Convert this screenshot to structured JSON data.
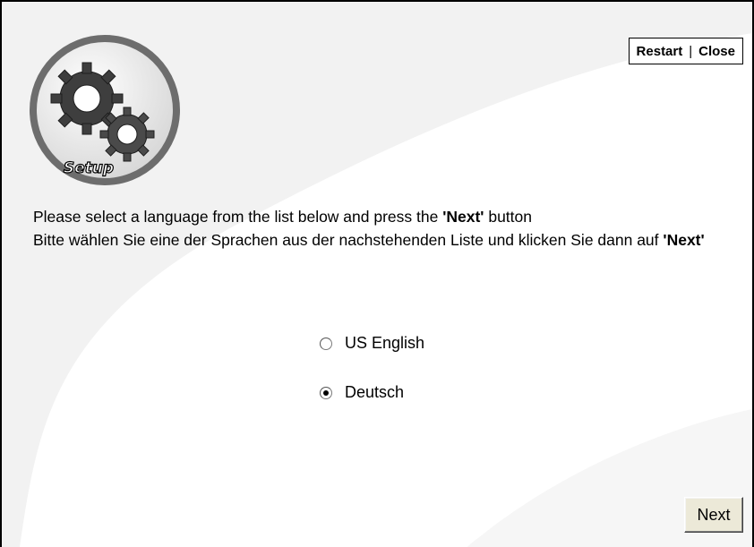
{
  "header": {
    "logo_label": "Setup",
    "restart_label": "Restart",
    "separator": "|",
    "close_label": "Close"
  },
  "instructions": {
    "en_prefix": "Please select a language from the list below and press the ",
    "en_bold": "'Next'",
    "en_suffix": " button",
    "de_prefix": "Bitte wählen Sie eine der Sprachen aus der nachstehenden Liste und klicken Sie dann auf ",
    "de_bold": "'Next'"
  },
  "languages": [
    {
      "label": "US English",
      "selected": false
    },
    {
      "label": "Deutsch",
      "selected": true
    }
  ],
  "footer": {
    "next_label": "Next"
  },
  "colors": {
    "background": "#f2f2f2",
    "swoosh": "#ffffff",
    "button_face": "#ece9d8"
  }
}
